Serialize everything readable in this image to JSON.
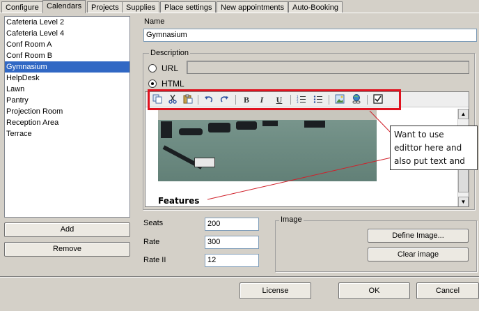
{
  "tabs": [
    "Configure",
    "Calendars",
    "Projects",
    "Supplies",
    "Place settings",
    "New appointments",
    "Auto-Booking"
  ],
  "active_tab": "Calendars",
  "calendars": {
    "items": [
      "Cafeteria Level 2",
      "Cafeteria Level 4",
      "Conf Room A",
      "Conf Room B",
      "Gymnasium",
      "HelpDesk",
      "Lawn",
      "Pantry",
      "Projection Room",
      "Reception Area",
      "Terrace"
    ],
    "selected": "Gymnasium",
    "add_label": "Add",
    "remove_label": "Remove"
  },
  "name": {
    "label": "Name",
    "value": "Gymnasium"
  },
  "description": {
    "title": "Description",
    "url_label": "URL",
    "html_label": "HTML",
    "selected_option": "HTML",
    "url_value": ""
  },
  "editor": {
    "toolbar_icons": [
      "copy-icon",
      "cut-icon",
      "paste-icon",
      "undo-icon",
      "redo-icon",
      "bold-icon",
      "italic-icon",
      "underline-icon",
      "ordered-list-icon",
      "unordered-list-icon",
      "insert-image-icon",
      "insert-link-icon",
      "checkbox-icon"
    ],
    "toolbar_glyphs": {
      "bold": "B",
      "italic": "I",
      "underline": "U"
    },
    "heading": "Features"
  },
  "annotation": {
    "text": "Want to use edittor here and also put text and link here",
    "highlight_color": "#e0121f"
  },
  "fields": {
    "seats": {
      "label": "Seats",
      "value": "200"
    },
    "rate": {
      "label": "Rate",
      "value": "300"
    },
    "rate2": {
      "label": "Rate II",
      "value": "12"
    }
  },
  "image_group": {
    "title": "Image",
    "define_label": "Define Image...",
    "clear_label": "Clear image"
  },
  "footer": {
    "license_label": "License",
    "ok_label": "OK",
    "cancel_label": "Cancel"
  },
  "colors": {
    "selection": "#3168c4",
    "window": "#d4d0c8"
  }
}
